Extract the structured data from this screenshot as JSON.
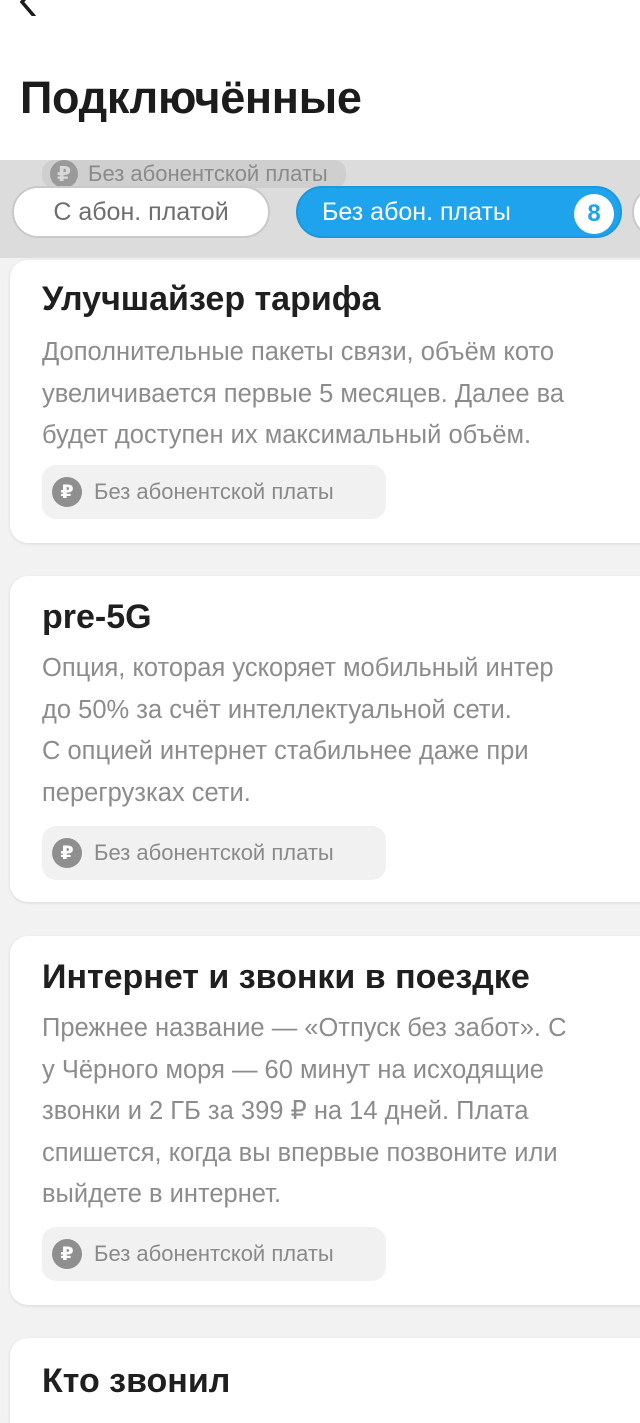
{
  "header": {
    "title": "Подключённые"
  },
  "filters": {
    "ghost_badge": "Без абонентской платы",
    "paid_label": "С абон. платой",
    "free_label": "Без абон. платы",
    "free_count": "8"
  },
  "cards": [
    {
      "title": "Улучшайзер тарифа",
      "desc": [
        "Дополнительные пакеты связи, объём кото",
        "увеличивается первые 5 месяцев. Далее ва",
        "будет доступен их максимальный объём."
      ],
      "badge": "Без абонентской платы"
    },
    {
      "title": "pre-5G",
      "desc": [
        "Опция, которая ускоряет мобильный интер",
        "до 50% за счёт интеллектуальной сети.",
        "С опцией интернет стабильнее даже при",
        "перегрузках сети."
      ],
      "badge": "Без абонентской платы"
    },
    {
      "title": "Интернет и звонки в поездке",
      "desc": [
        "Прежнее название — «Отпуск без забот». С",
        "у Чёрного моря — 60 минут на исходящие",
        "звонки и 2 ГБ за 399 ₽ на 14 дней. Плата",
        "спишется, когда вы впервые позвоните или",
        "выйдете в интернет."
      ],
      "badge": "Без абонентской платы"
    },
    {
      "title": "Кто звонил",
      "desc": [],
      "badge": ""
    }
  ],
  "icons": {
    "back": "chevron-left-icon",
    "ruble": "ruble-icon",
    "ruble_glyph": "₽"
  },
  "colors": {
    "accent": "#1fa3ec",
    "background": "#f2f2f2",
    "card": "#ffffff",
    "muted_text": "#8c8c8c"
  }
}
